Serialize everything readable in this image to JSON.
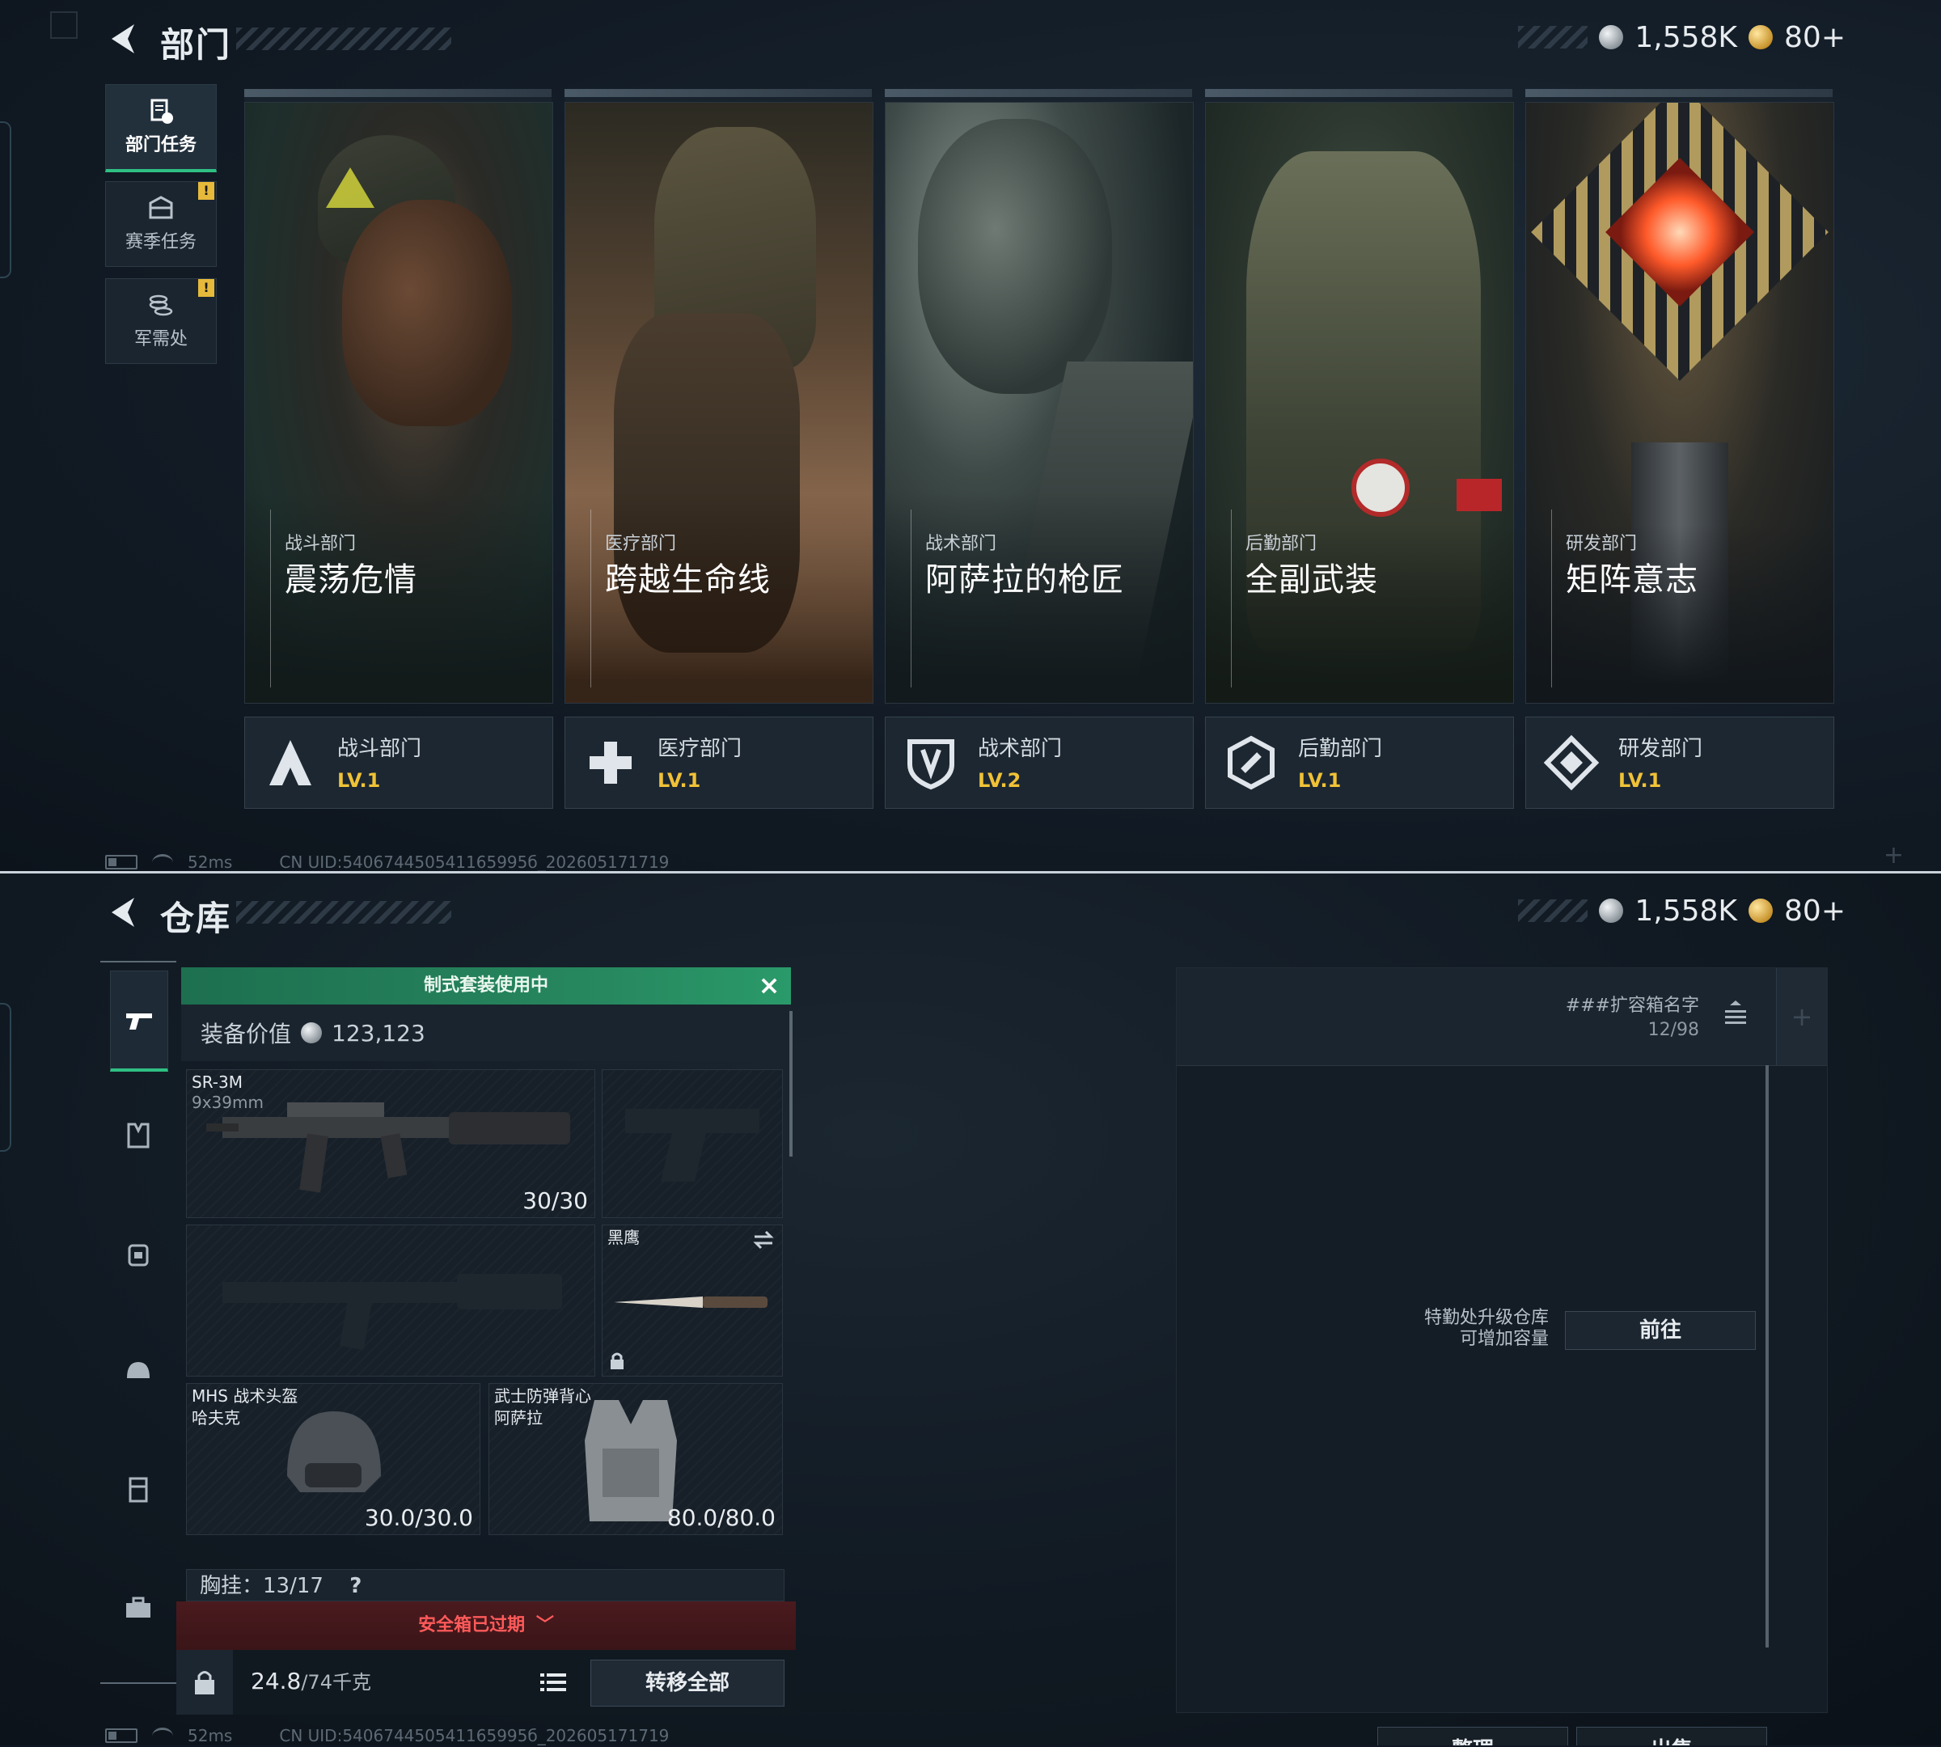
{
  "top": {
    "title": "部门",
    "currency": {
      "silver": "1,558K",
      "gold": "80+"
    },
    "side_tabs": [
      {
        "label": "部门任务",
        "icon": "document-task-icon",
        "active": true,
        "badge": ""
      },
      {
        "label": "赛季任务",
        "icon": "chest-icon",
        "active": false,
        "badge": "!"
      },
      {
        "label": "军需处",
        "icon": "coins-icon",
        "active": false,
        "badge": "!"
      }
    ],
    "departments": [
      {
        "category": "战斗部门",
        "mission": "震荡危情",
        "name": "战斗部门",
        "level": "LV.1",
        "icon": "combat-a-icon"
      },
      {
        "category": "医疗部门",
        "mission": "跨越生命线",
        "name": "医疗部门",
        "level": "LV.1",
        "icon": "medical-cross-icon"
      },
      {
        "category": "战术部门",
        "mission": "阿萨拉的枪匠",
        "name": "战术部门",
        "level": "LV.2",
        "icon": "tactical-shield-icon"
      },
      {
        "category": "后勤部门",
        "mission": "全副武装",
        "name": "后勤部门",
        "level": "LV.1",
        "icon": "logistics-icon"
      },
      {
        "category": "研发部门",
        "mission": "矩阵意志",
        "name": "研发部门",
        "level": "LV.1",
        "icon": "research-diamond-icon"
      }
    ],
    "status": {
      "ping": "52ms",
      "uid": "CN UID:540674450541165995б_202605171719"
    }
  },
  "bottom": {
    "title": "仓库",
    "currency": {
      "silver": "1,558K",
      "gold": "80+"
    },
    "loadout": {
      "banner": "制式套装使用中",
      "value_label": "装备价值",
      "value": "123,123",
      "primary": {
        "name": "SR-3M",
        "caliber": "9x39mm",
        "ammo": "30/30"
      },
      "melee": {
        "name": "黑鹰"
      },
      "helmet": {
        "name": "MHS 战术头盔",
        "sub": "哈夫克",
        "durability": "30.0/30.0"
      },
      "armor": {
        "name": "武士防弹背心",
        "sub": "阿萨拉",
        "durability": "80.0/80.0"
      },
      "chest_rig": "胸挂：13/17",
      "chest_help": "?",
      "expired": "安全箱已过期",
      "weight": "24.8",
      "weight_max": "/74千克",
      "transfer_all": "转移全部"
    },
    "storage": {
      "box_name": "###扩容箱名字",
      "box_capacity": "12/98",
      "add": "+",
      "upgrade_hint": "特勤处升级仓库可增加容量",
      "goto": "前往",
      "organize": "整理",
      "sell": "出售"
    },
    "status": {
      "ping": "52ms",
      "uid": "CN UID:540674450541165995б_202605171719"
    }
  }
}
